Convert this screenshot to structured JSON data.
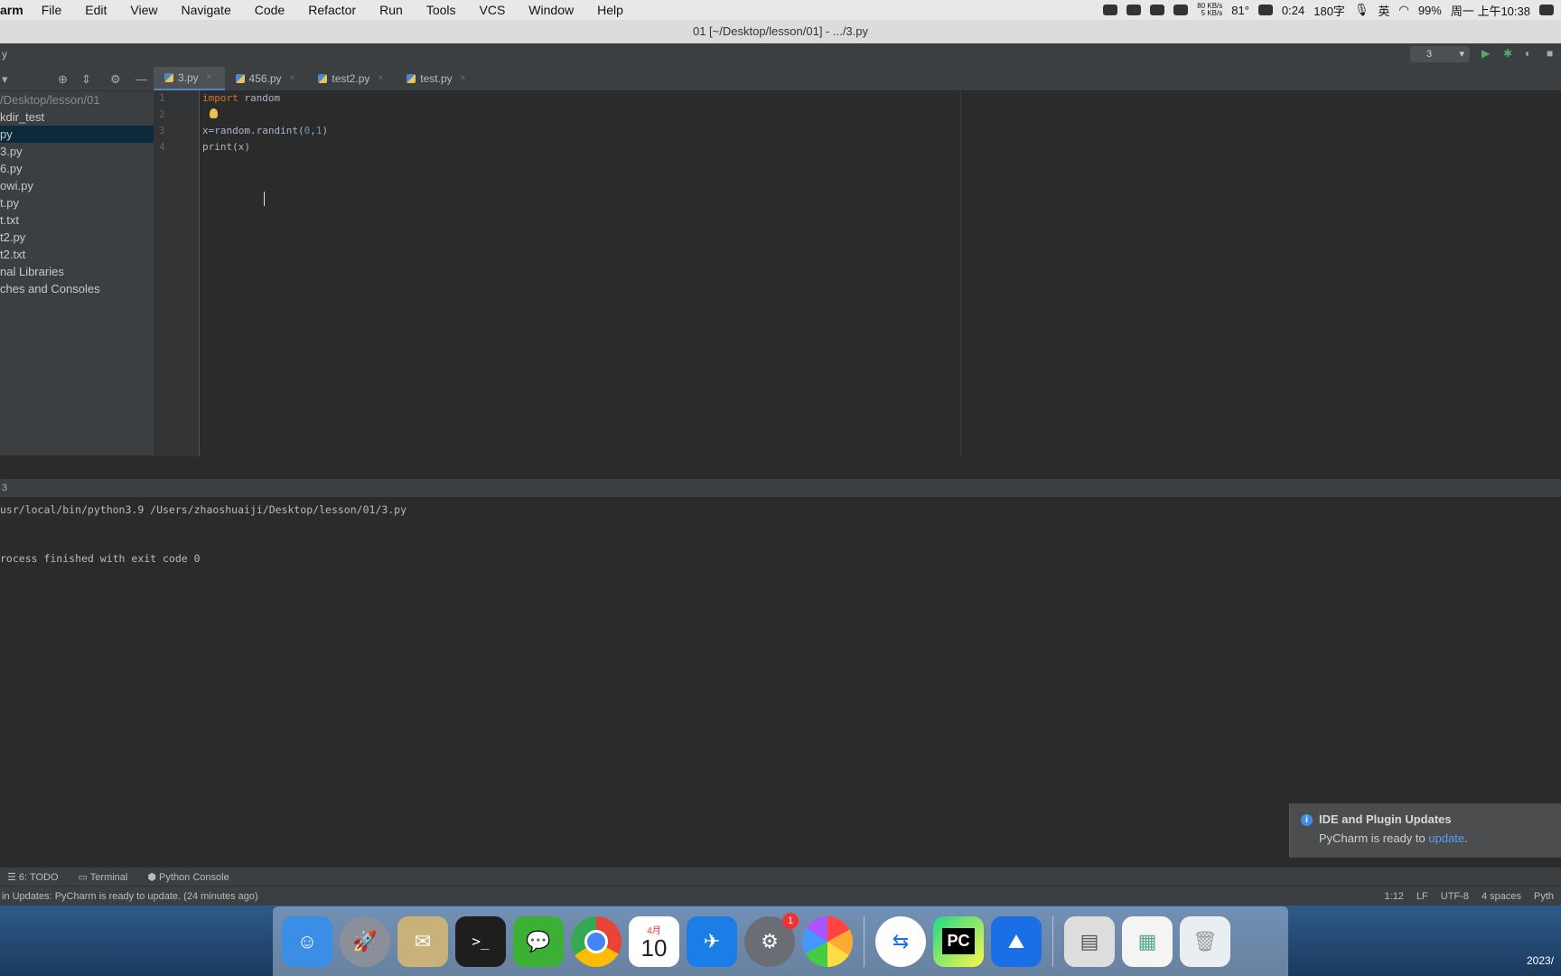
{
  "menubar": {
    "app_name": "arm",
    "items": [
      "File",
      "Edit",
      "View",
      "Navigate",
      "Code",
      "Refactor",
      "Run",
      "Tools",
      "VCS",
      "Window",
      "Help"
    ],
    "net_up": "80 KB/s",
    "net_down": "5 KB/s",
    "temp": "81°",
    "battery_time": "0:24",
    "word_count": "180字",
    "lang": "英",
    "battery_pct": "99%",
    "datetime": "周一 上午10:38"
  },
  "window": {
    "title": "01 [~/Desktop/lesson/01] - .../3.py"
  },
  "navbar": {
    "left_label": "y",
    "run_config": "3"
  },
  "project": {
    "path": "/Desktop/lesson/01",
    "items": [
      {
        "label": "kdir_test",
        "selected": false
      },
      {
        "label": "py",
        "selected": true
      },
      {
        "label": "3.py",
        "selected": false
      },
      {
        "label": "6.py",
        "selected": false
      },
      {
        "label": "owi.py",
        "selected": false
      },
      {
        "label": "t.py",
        "selected": false
      },
      {
        "label": "t.txt",
        "selected": false
      },
      {
        "label": "t2.py",
        "selected": false
      },
      {
        "label": "t2.txt",
        "selected": false
      },
      {
        "label": "nal Libraries",
        "selected": false
      },
      {
        "label": "ches and Consoles",
        "selected": false
      }
    ]
  },
  "tabs": [
    {
      "label": "3.py",
      "active": true
    },
    {
      "label": "456.py",
      "active": false
    },
    {
      "label": "test2.py",
      "active": false
    },
    {
      "label": "test.py",
      "active": false
    }
  ],
  "editor": {
    "line_numbers": [
      "1",
      "2",
      "3",
      "4"
    ],
    "line1": {
      "kw": "import",
      "rest": " random"
    },
    "line3": {
      "a": "x=random.randint(",
      "n1": "0",
      "c": ",",
      "n2": "1",
      "b": ")"
    },
    "line4": "print(x)"
  },
  "run_panel": {
    "tab_label": "3"
  },
  "console": {
    "lines": [
      "usr/local/bin/python3.9 /Users/zhaoshuaiji/Desktop/lesson/01/3.py",
      "",
      "",
      "rocess finished with exit code 0"
    ]
  },
  "notification": {
    "title": "IDE and Plugin Updates",
    "body": "PyCharm is ready to ",
    "link": "update",
    "suffix": "."
  },
  "toolstrip": {
    "todo": "6: TODO",
    "terminal": "Terminal",
    "python_console": "Python Console"
  },
  "statusbar": {
    "message": "in Updates: PyCharm is ready to update. (24 minutes ago)",
    "position": "1:12",
    "line_sep": "LF",
    "encoding": "UTF-8",
    "indent": "4 spaces",
    "interpreter": "Pyth"
  },
  "dock": {
    "calendar_month": "4月",
    "calendar_day": "10",
    "settings_badge": "1",
    "pycharm_label": "PC"
  },
  "corner_date": "2023/"
}
